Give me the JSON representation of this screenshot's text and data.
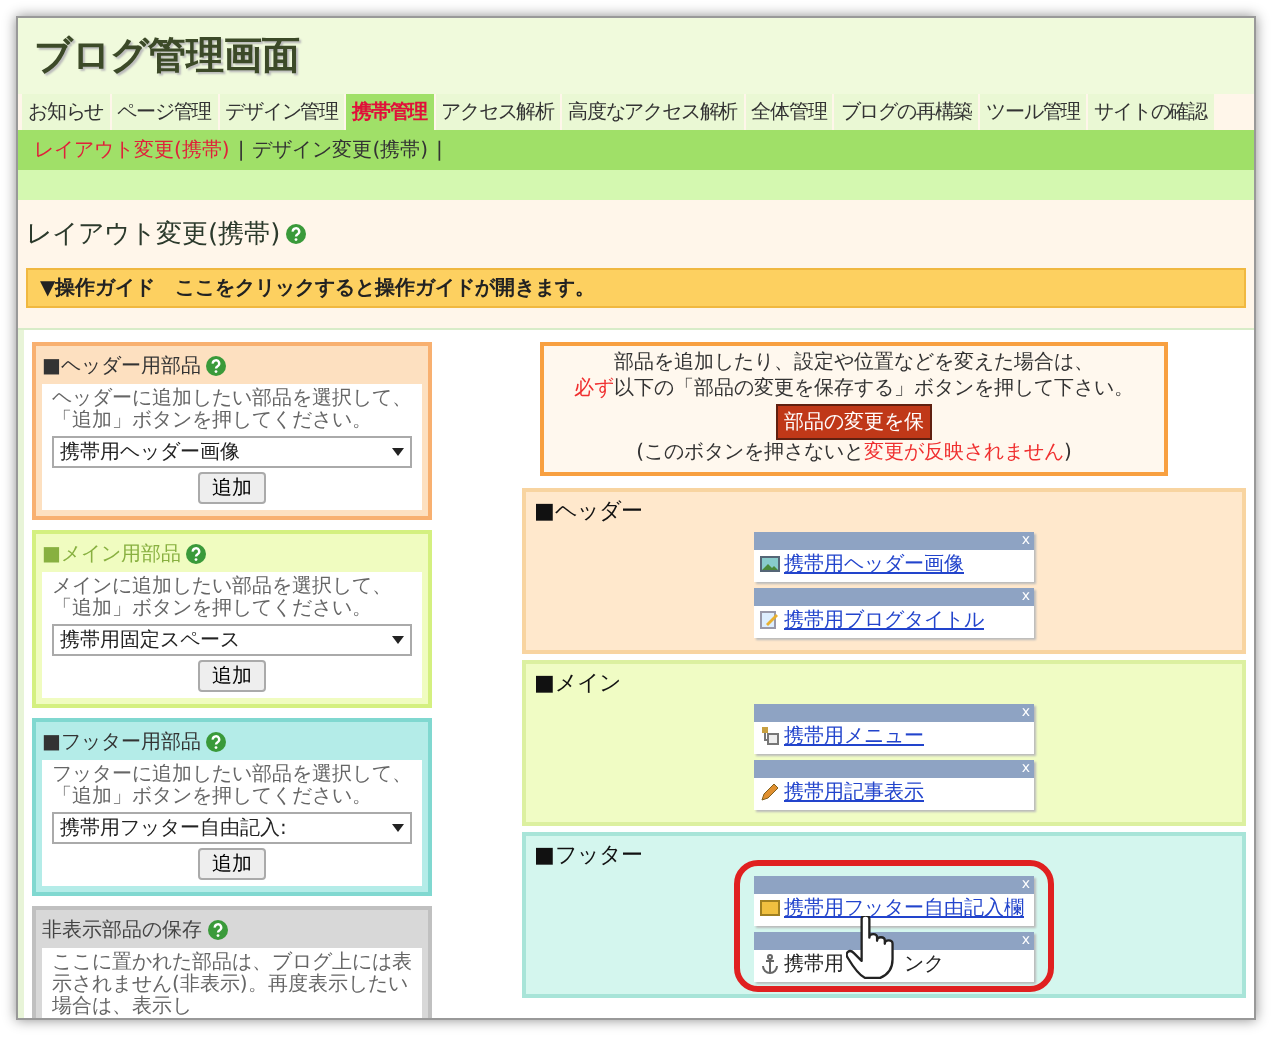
{
  "title": "ブログ管理画面",
  "tabs": [
    {
      "label": "お知らせ",
      "selected": false
    },
    {
      "label": "ページ管理",
      "selected": false
    },
    {
      "label": "デザイン管理",
      "selected": false
    },
    {
      "label": "携帯管理",
      "selected": true
    },
    {
      "label": "アクセス解析",
      "selected": false
    },
    {
      "label": "高度なアクセス解析",
      "selected": false
    },
    {
      "label": "全体管理",
      "selected": false
    },
    {
      "label": "ブログの再構築",
      "selected": false
    },
    {
      "label": "ツール管理",
      "selected": false
    },
    {
      "label": "サイトの確認",
      "selected": false
    }
  ],
  "subnav": [
    {
      "label": "レイアウト変更(携帯)",
      "selected": true,
      "separator": "|"
    },
    {
      "label": "デザイン変更(携帯)",
      "selected": false,
      "separator": "|"
    }
  ],
  "page_heading": "レイアウト変更(携帯)",
  "guide_bar": {
    "label": "▼操作ガイド",
    "text": "ここをクリックすると操作ガイドが開きます。"
  },
  "parts_panels": [
    {
      "kind": "header",
      "title": "■ヘッダー用部品",
      "description": "ヘッダーに追加したい部品を選択して、「追加」ボタンを押してください。",
      "select": "携帯用ヘッダー画像",
      "button": "追加"
    },
    {
      "kind": "main",
      "title": "■メイン用部品",
      "description": "メインに追加したい部品を選択して、「追加」ボタンを押してください。",
      "select": "携帯用固定スペース",
      "button": "追加"
    },
    {
      "kind": "footer",
      "title": "■フッター用部品",
      "description": "フッターに追加したい部品を選択して、「追加」ボタンを押してください。",
      "select": "携帯用フッター自由記入:",
      "button": "追加"
    },
    {
      "kind": "hidden",
      "title": "非表示部品の保存",
      "description": "ここに置かれた部品は、ブログ上には表示されません(非表示)。再度表示したい場合は、表示し"
    }
  ],
  "notice": {
    "line1": [
      {
        "text": "部品を追加したり、設定や位置などを変えた場合は、",
        "alert": false
      }
    ],
    "line2": [
      {
        "text": "必ず",
        "alert": true
      },
      {
        "text": "以下の「部品の変更を保存する」ボタンを押して下さい。",
        "alert": false
      }
    ],
    "button": "部品の変更を保",
    "line3": [
      {
        "text": "(このボタンを押さないと",
        "alert": false
      },
      {
        "text": "変更が反映されません",
        "alert": true
      },
      {
        "text": ")",
        "alert": false
      }
    ]
  },
  "sections": [
    {
      "kind": "header",
      "heading": "■ヘッダー",
      "widgets": [
        {
          "label": "携帯用ヘッダー画像",
          "close": "x"
        },
        {
          "label": "携帯用ブログタイトル",
          "close": "x"
        }
      ]
    },
    {
      "kind": "main",
      "heading": "■メイン",
      "widgets": [
        {
          "label": "携帯用メニュー",
          "close": "x"
        },
        {
          "label": "携帯用記事表示",
          "close": "x"
        }
      ]
    },
    {
      "kind": "footer",
      "heading": "■フッター",
      "highlighted": true,
      "widgets": [
        {
          "label": "携帯用フッター自由記入欄",
          "close": "x"
        },
        {
          "label": "携帯用",
          "label_tail": "ンク",
          "close": "x"
        }
      ]
    }
  ]
}
